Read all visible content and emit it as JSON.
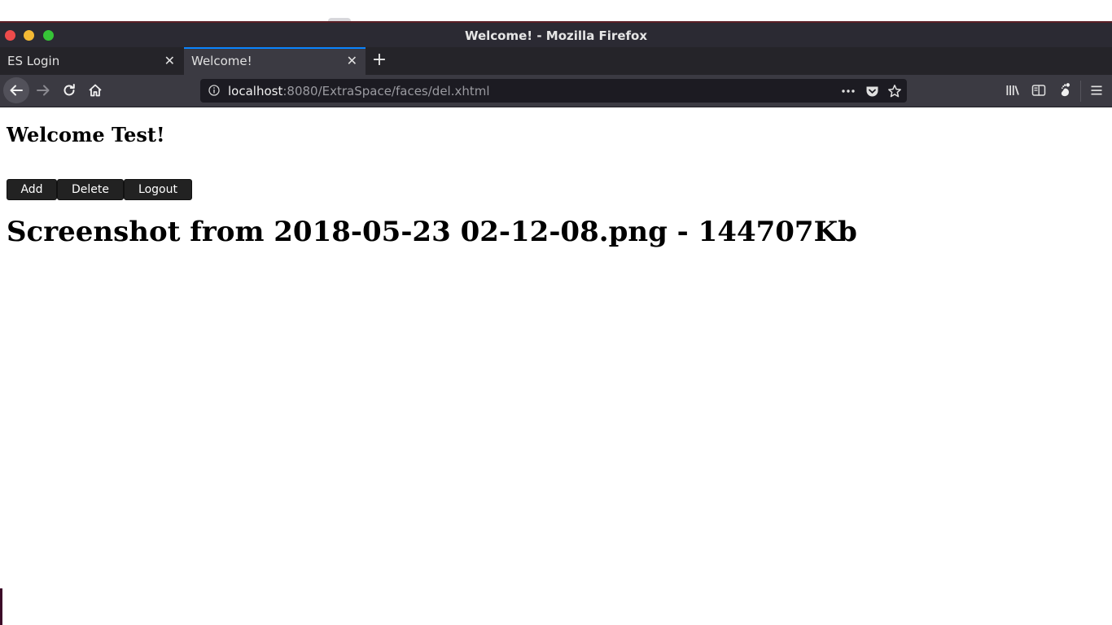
{
  "window": {
    "title": "Welcome! - Mozilla Firefox"
  },
  "tabs": [
    {
      "label": "ES Login",
      "active": false
    },
    {
      "label": "Welcome!",
      "active": true
    }
  ],
  "tab_close_glyph": "✕",
  "new_tab_glyph": "+",
  "urlbar": {
    "host": "localhost",
    "path": ":8080/ExtraSpace/faces/del.xhtml"
  },
  "page": {
    "heading": "Welcome Test!",
    "buttons": {
      "add": "Add",
      "delete": "Delete",
      "logout": "Logout"
    },
    "file_entry": "Screenshot from 2018-05-23 02-12-08.png - 144707Kb"
  },
  "colors": {
    "window_close": "#ee4b4b",
    "window_minimize": "#f4b934",
    "window_maximize": "#36c437",
    "active_tab_accent": "#0a84ff",
    "page_button_bg": "#222222"
  },
  "icons": {
    "back": "back-arrow-icon",
    "forward": "forward-arrow-icon",
    "reload": "reload-icon",
    "home": "home-icon",
    "info": "info-icon",
    "more": "more-dots-icon",
    "pocket": "pocket-icon",
    "bookmark": "star-icon",
    "library": "library-icon",
    "sidebar": "sidebar-icon",
    "extension": "gnome-foot-icon",
    "menu": "hamburger-menu-icon"
  }
}
